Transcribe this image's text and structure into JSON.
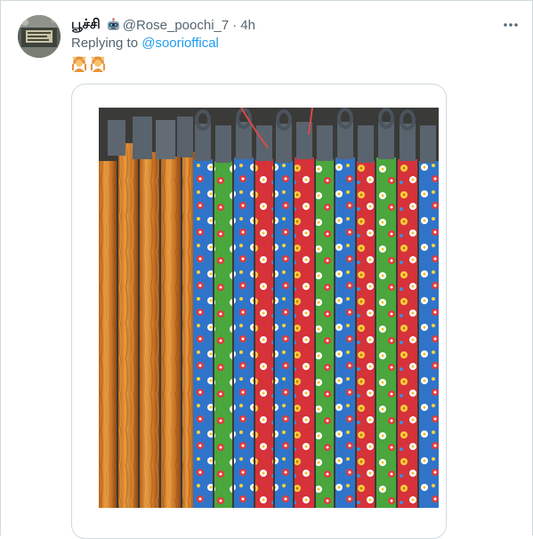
{
  "tweet": {
    "display_name": "பூச்சி",
    "handle": "@Rose_poochi_7",
    "separator": "·",
    "time": "4h",
    "reply_prefix": "Replying to ",
    "reply_mention": "@soorioffical",
    "emoji_icons": [
      "woman-gesturing-ok-icon",
      "woman-gesturing-ok-icon"
    ]
  },
  "image": {
    "subject_icon": "broom-sticks-photo"
  },
  "colors": {
    "text_primary": "#0f1419",
    "text_secondary": "#536471",
    "link": "#1d9bf0",
    "border": "#cfd9de"
  }
}
